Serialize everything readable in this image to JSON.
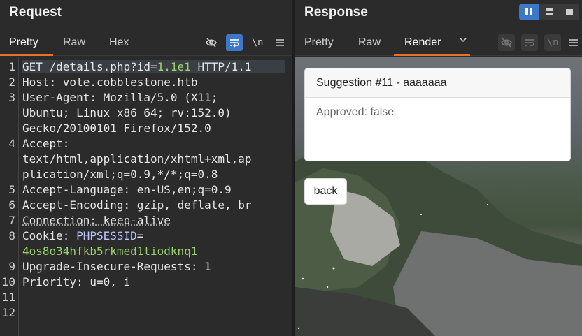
{
  "request": {
    "title": "Request",
    "tabs": [
      "Pretty",
      "Raw",
      "Hex"
    ],
    "active_tab": "Pretty",
    "tools": {
      "hide_icon": "eye-off-icon",
      "wrap_icon": "wrap-icon",
      "newline_label": "\\n",
      "menu_icon": "menu-icon"
    },
    "line_numbers": [
      "1",
      "2",
      "3",
      "4",
      "5",
      "6",
      "7",
      "8",
      "9",
      "10",
      "11",
      "12"
    ],
    "lines": {
      "l1": {
        "method": "GET /details.php?id=",
        "num": "1.1e1",
        "proto": " HTTP/1.1"
      },
      "l2": {
        "name": "Host",
        "sep": ": ",
        "value": "vote.cobblestone.htb"
      },
      "l3a": {
        "name": "User-Agent",
        "sep": ": ",
        "value": "Mozilla/5.0 (X11;"
      },
      "l3b": "Ubuntu; Linux x86_64; rv:152.0)",
      "l3c": "Gecko/20100101 Firefox/152.0",
      "l4a": {
        "name": "Accept",
        "sep": ":"
      },
      "l4b": "text/html,application/xhtml+xml,ap",
      "l4c": "plication/xml;q=0.9,*/*;q=0.8",
      "l5": {
        "name": "Accept-Language",
        "sep": ": ",
        "value": "en-US,en;q=0.9"
      },
      "l6": {
        "name": "Accept-Encoding",
        "sep": ": ",
        "value": "gzip, deflate, br"
      },
      "l7": {
        "name": "Connection",
        "sep": ": ",
        "value": "keep-alive"
      },
      "l8a": {
        "name": "Cookie",
        "sep": ": ",
        "cookie": "PHPSESSID",
        "eq": "="
      },
      "l8b": "4os8o34hfkb5rkmed1tiodknq1",
      "l9": {
        "name": "Upgrade-Insecure-Requests",
        "sep": ": ",
        "value": "1"
      },
      "l10": {
        "name": "Priority",
        "sep": ": ",
        "value": "u=0, i"
      }
    }
  },
  "response": {
    "title": "Response",
    "tabs": [
      "Pretty",
      "Raw",
      "Render"
    ],
    "active_tab": "Render",
    "tab_dropdown_icon": "chevron-down-icon",
    "render": {
      "card_title": "Suggestion #11 - aaaaaaa",
      "card_body": "Approved: false",
      "back_label": "back"
    }
  },
  "colors": {
    "accent_orange": "#e8702a",
    "active_blue": "#3d78c8",
    "green_value": "#9bd16a",
    "cookie_blue": "#b9c6ff"
  }
}
